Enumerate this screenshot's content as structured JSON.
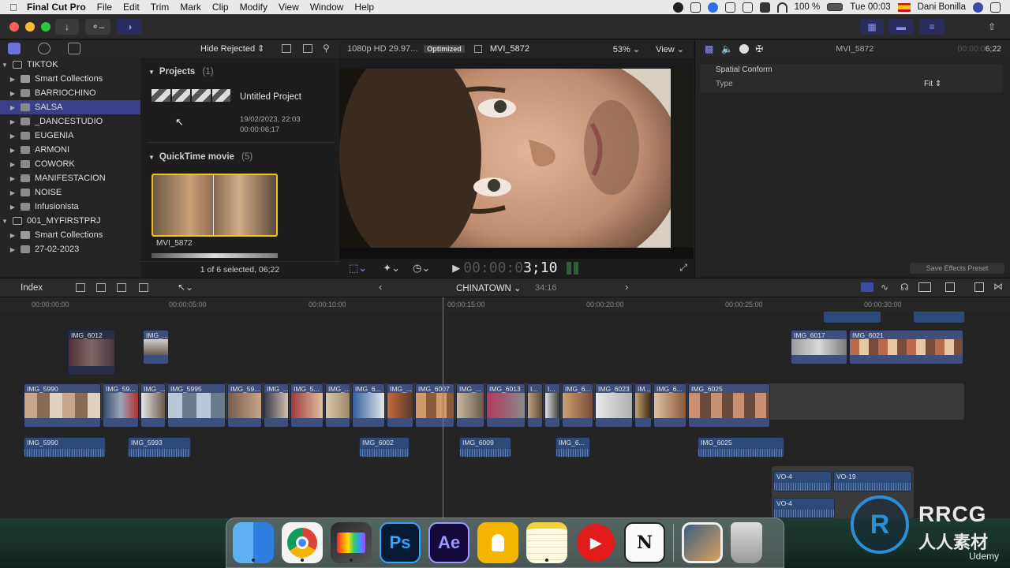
{
  "menubar": {
    "app": "Final Cut Pro",
    "menus": [
      "File",
      "Edit",
      "Trim",
      "Mark",
      "Clip",
      "Modify",
      "View",
      "Window",
      "Help"
    ],
    "battery": "100 %",
    "clock": "Tue 00:03",
    "user": "Dani Bonilla"
  },
  "library": {
    "rows": [
      {
        "label": "TIKTOK",
        "kind": "library",
        "expanded": true
      },
      {
        "label": "Smart Collections",
        "kind": "folder"
      },
      {
        "label": "BARRIOCHINO",
        "kind": "event"
      },
      {
        "label": "SALSA",
        "kind": "event",
        "selected": true
      },
      {
        "label": "_DANCESTUDIO",
        "kind": "event"
      },
      {
        "label": "EUGENIA",
        "kind": "event"
      },
      {
        "label": "ARMONI",
        "kind": "event"
      },
      {
        "label": "COWORK",
        "kind": "event"
      },
      {
        "label": "MANIFESTACION",
        "kind": "event"
      },
      {
        "label": "NOISE",
        "kind": "event"
      },
      {
        "label": "Infusionista",
        "kind": "event"
      },
      {
        "label": "001_MYFIRSTPRJ",
        "kind": "library",
        "expanded": true
      },
      {
        "label": "Smart Collections",
        "kind": "folder"
      },
      {
        "label": "27-02-2023",
        "kind": "event"
      }
    ]
  },
  "browser": {
    "filter": "Hide Rejected",
    "projects_heading": "Projects",
    "projects_count": "(1)",
    "project_name": "Untitled Project",
    "project_date": "19/02/2023, 22:03",
    "project_duration": "00:00:06;17",
    "qt_heading": "QuickTime movie",
    "qt_count": "(5)",
    "clip_name": "MVI_5872",
    "status": "1 of 6 selected, 06;22"
  },
  "viewer": {
    "format": "1080p HD 29.97...",
    "badge": "Optimized",
    "clip": "MVI_5872",
    "zoom": "53%",
    "view": "View",
    "timecode_dim": "00:00:0",
    "timecode": "3;10"
  },
  "inspector": {
    "clip": "MVI_5872",
    "duration_dim": "00:00:0",
    "duration": "6;22",
    "section": "Spatial Conform",
    "type_label": "Type",
    "type_value": "Fit",
    "save_button": "Save Effects Preset"
  },
  "timeline": {
    "index": "Index",
    "project": "CHINATOWN",
    "duration": "34:16",
    "ruler": [
      "00:00:00:00",
      "00:00:05:00",
      "00:00:10:00",
      "00:00:15:00",
      "00:00:20:00",
      "00:00:25:00",
      "00:00:30:00"
    ],
    "connected": [
      "IMG_6012",
      "IMG_...",
      "IMG_6017",
      "IMG_6021"
    ],
    "primary": [
      "IMG_5990",
      "IMG_59...",
      "IMG_...",
      "IMG_5995",
      "IMG_59...",
      "IMG_...",
      "IMG_5...",
      "IMG_...",
      "IMG_6...",
      "IMG_...",
      "IMG_6007",
      "IMG_...",
      "IMG_6013",
      "I...",
      "I...",
      "IMG_6...",
      "IMG_6023",
      "IM...",
      "IMG_6...",
      "IMG_6025"
    ],
    "audio": [
      "IMG_5990",
      "IMG_5993",
      "IMG_6002",
      "IMG_6009",
      "IMG_6...",
      "IMG_6025"
    ],
    "vo": [
      "VO-4",
      "VO-19",
      "VO-4"
    ]
  },
  "dock": {
    "apps": [
      "finder-icon",
      "chrome-icon",
      "final-cut-icon",
      "photoshop-icon",
      "after-effects-icon",
      "keynote-icon",
      "notes-icon",
      "youtube-icon",
      "notion-icon",
      "preview-icon",
      "trash-icon"
    ],
    "ps": "Ps",
    "ae": "Ae",
    "notion": "N"
  },
  "watermark": {
    "brand": "RRCG",
    "sub": "人人素材",
    "footer": "Udemy"
  },
  "colors": {
    "selection": "#3b3f8a",
    "accent": "#8b8ff5",
    "playhead": "#e0563a",
    "clip": "#3d4f7a",
    "audio": "#2e4a78"
  }
}
